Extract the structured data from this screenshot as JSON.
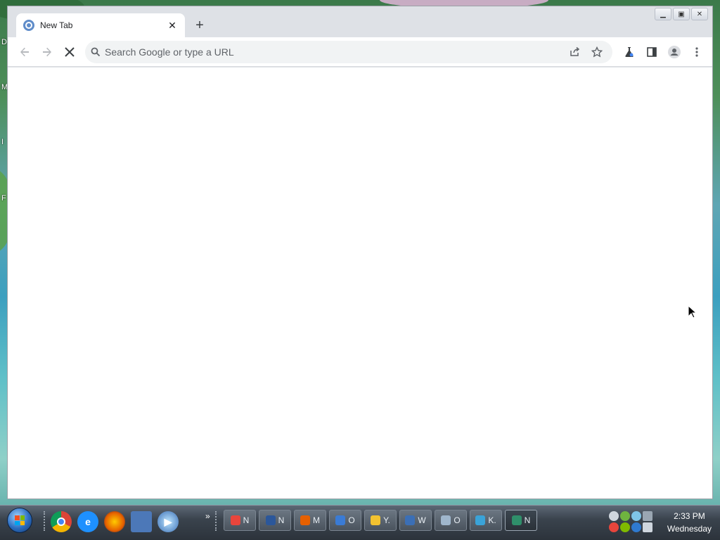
{
  "desktop": {
    "edge_letters": [
      "D",
      "M",
      "I",
      "F"
    ]
  },
  "window": {
    "tab": {
      "title": "New Tab",
      "close_glyph": "✕"
    },
    "new_tab_glyph": "+",
    "controls": {
      "minimize": "▁",
      "restore": "▣",
      "close": "✕"
    }
  },
  "toolbar": {
    "omnibox": {
      "placeholder": "Search Google or type a URL",
      "value": ""
    }
  },
  "taskbar": {
    "quick_launch_more": "»",
    "buttons": [
      {
        "icon": "chrome-icon",
        "label": "N",
        "color": "#e8453c"
      },
      {
        "icon": "word-icon",
        "label": "N",
        "color": "#2b579a"
      },
      {
        "icon": "firefox-icon",
        "label": "M",
        "color": "#e66000"
      },
      {
        "icon": "thunderbird-icon",
        "label": "O",
        "color": "#3a7bd5"
      },
      {
        "icon": "messenger-icon",
        "label": "Y.",
        "color": "#f2c230"
      },
      {
        "icon": "media-player-icon",
        "label": "W",
        "color": "#3b6fb6"
      },
      {
        "icon": "folder-icon",
        "label": "O",
        "color": "#9fb6cc"
      },
      {
        "icon": "globe-icon",
        "label": "K.",
        "color": "#3aa3d8"
      },
      {
        "icon": "browser-icon",
        "label": "N",
        "color": "#2f8f6a",
        "active": true
      }
    ],
    "clock": {
      "time": "2:33 PM",
      "day": "Wednesday"
    }
  }
}
